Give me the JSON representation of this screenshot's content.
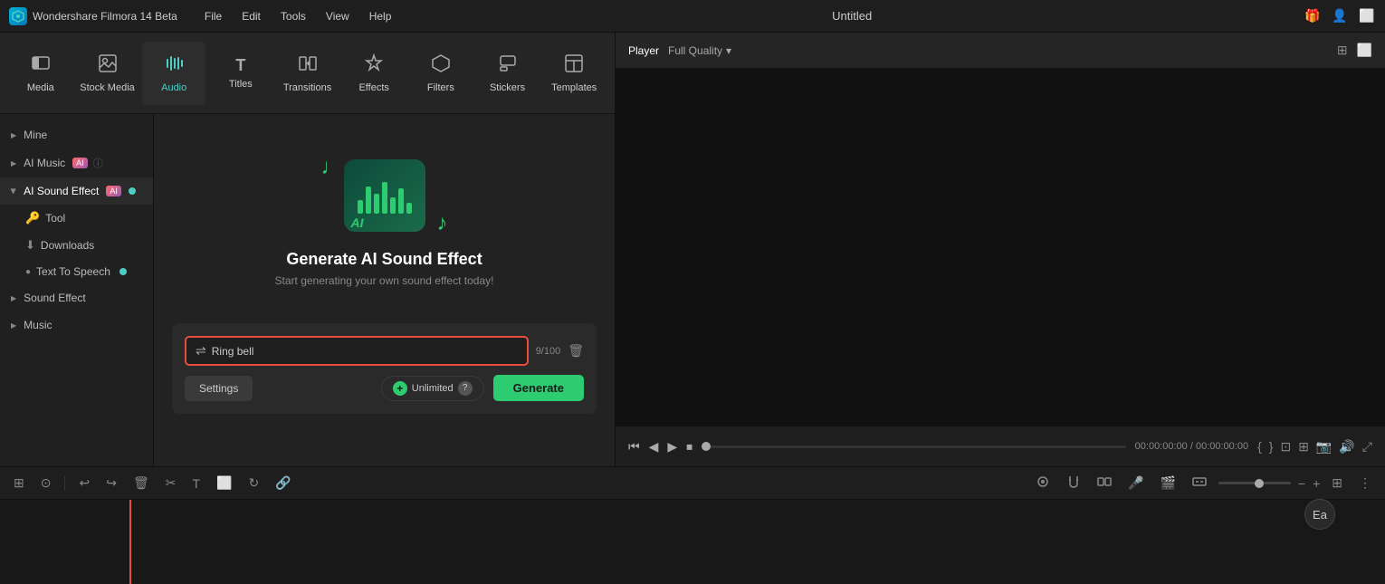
{
  "app": {
    "name": "Wondershare Filmora 14 Beta",
    "title": "Untitled",
    "logo_text": "W"
  },
  "menu": {
    "items": [
      "File",
      "Edit",
      "Tools",
      "View",
      "Help"
    ]
  },
  "toolbar": {
    "items": [
      {
        "id": "media",
        "label": "Media",
        "icon": "🎬"
      },
      {
        "id": "stock",
        "label": "Stock Media",
        "icon": "📷"
      },
      {
        "id": "audio",
        "label": "Audio",
        "icon": "🎵"
      },
      {
        "id": "titles",
        "label": "Titles",
        "icon": "T"
      },
      {
        "id": "transitions",
        "label": "Transitions",
        "icon": "↔"
      },
      {
        "id": "effects",
        "label": "Effects",
        "icon": "✨"
      },
      {
        "id": "filters",
        "label": "Filters",
        "icon": "⬡"
      },
      {
        "id": "stickers",
        "label": "Stickers",
        "icon": "🔷"
      },
      {
        "id": "templates",
        "label": "Templates",
        "icon": "⬜"
      }
    ],
    "active": "audio"
  },
  "sidebar": {
    "sections": [
      {
        "id": "mine",
        "label": "Mine",
        "type": "collapsed",
        "indent": 0
      },
      {
        "id": "ai-music",
        "label": "AI Music",
        "type": "collapsed",
        "indent": 0,
        "badge": "AI",
        "has_info": true
      },
      {
        "id": "ai-sound-effect",
        "label": "AI Sound Effect",
        "type": "expanded",
        "indent": 0,
        "badge": "AI",
        "has_dot": true
      },
      {
        "id": "tool",
        "label": "Tool",
        "type": "sub",
        "icon": "🔑"
      },
      {
        "id": "downloads",
        "label": "Downloads",
        "type": "sub",
        "icon": "⬇"
      },
      {
        "id": "text-to-speech",
        "label": "Text To Speech",
        "type": "sub",
        "icon": "",
        "has_dot": true
      },
      {
        "id": "sound-effect",
        "label": "Sound Effect",
        "type": "collapsed-sub",
        "indent": 0
      },
      {
        "id": "music",
        "label": "Music",
        "type": "collapsed",
        "indent": 0
      }
    ]
  },
  "content": {
    "generate_title": "Generate AI Sound Effect",
    "generate_subtitle": "Start generating your own sound effect today!",
    "input_label": "Ring bell",
    "char_count": "9/100",
    "settings_label": "Settings",
    "unlimited_label": "Unlimited",
    "generate_label": "Generate"
  },
  "preview": {
    "tab_player": "Player",
    "quality": "Full Quality",
    "time_current": "00:00:00:00",
    "time_total": "00:00:00:00"
  },
  "bottom_toolbar": {
    "icons": [
      "⊞",
      "⊙",
      "⊡",
      "✂",
      "T",
      "⬜",
      "↻",
      "🔗"
    ]
  },
  "ea_badge": "Ea"
}
